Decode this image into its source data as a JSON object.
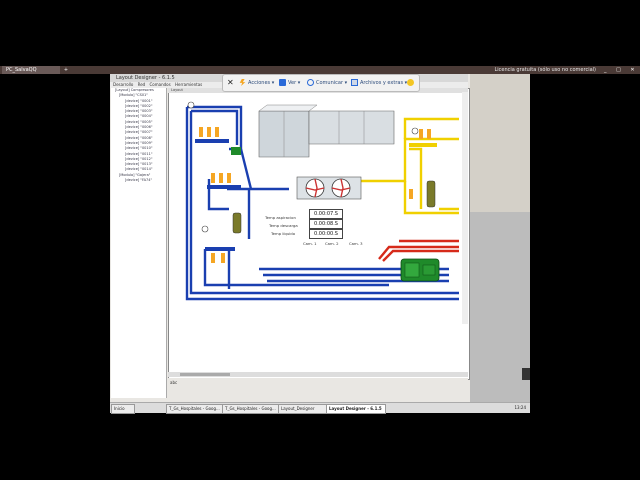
{
  "browser": {
    "tab_label": "PC_SalvaQQ",
    "add_tab": "+",
    "license_text": "Licencia gratuita (sólo uso no comercial)",
    "window_controls": "_ □ ✕"
  },
  "app": {
    "title": "Layout Designer - 6.1.5",
    "menu": [
      "Desarrollo",
      "Red",
      "Comandos",
      "Herramientas"
    ],
    "canvas_header": "Layout"
  },
  "toolbar": {
    "close_label": "✕",
    "acciones": "Acciones",
    "ver": "Ver",
    "comunicar": "Comunicar",
    "archivos": "Archivos y extras",
    "colors": {
      "orange": "#f5a623",
      "blue": "#2a6ad8",
      "yellow": "#f3c623"
    }
  },
  "tree": {
    "root": "[Layout] Compresores",
    "group1": "[Modulo] \"CS01\"",
    "devices1": [
      "[device] \"0001\"",
      "[device] \"0002\"",
      "[device] \"0003\"",
      "[device] \"0004\"",
      "[device] \"0005\"",
      "[device] \"0006\"",
      "[device] \"0007\"",
      "[device] \"0008\"",
      "[device] \"0009\"",
      "[device] \"0010\"",
      "[device] \"0011\"",
      "[device] \"0012\"",
      "[device] \"0013\"",
      "[device] \"0014\""
    ],
    "group2": "[Modulo] \"Gajera\"",
    "devices2": [
      "[device] \"FA74\""
    ]
  },
  "diagram": {
    "temp_aspiracion": "Temp aspiracion",
    "temp_descarga": "Temp descarga",
    "temp_liquido": "Temp líquido",
    "val_aspiracion": "0.00:07.S",
    "val_descarga": "0.00:08.S",
    "val_liquido": "0.00:00.S",
    "cam1": "Cam. 1",
    "cam2": "Cam. 2",
    "cam3": "Cam. 3",
    "pipe_colors": {
      "suction": "#1a3fb0",
      "discharge": "#d62a1a",
      "liquid": "#f0d000"
    }
  },
  "status": {
    "bottom_label": "abc"
  },
  "taskbar": {
    "start": "Inicio",
    "items": [
      "T_Gs_Hospitales - Goog...",
      "T_Gs_Hospitales - Goog...",
      "Layout_Designer",
      "Layout Designer - 6.1.5"
    ],
    "clock": "13:24"
  }
}
